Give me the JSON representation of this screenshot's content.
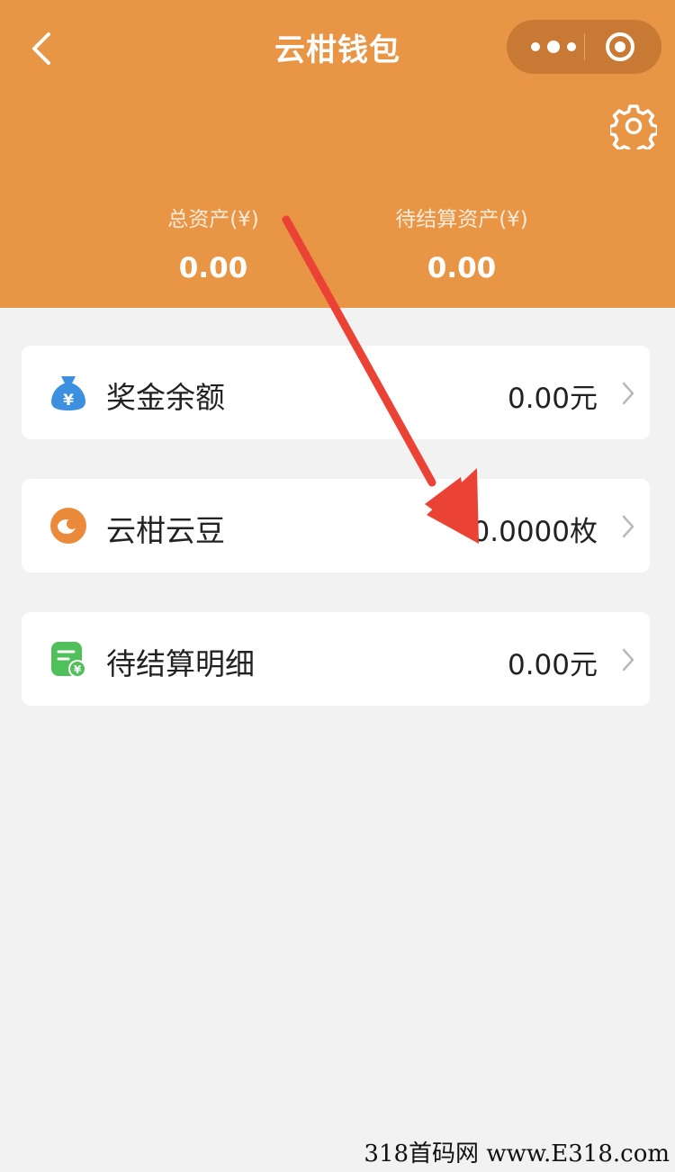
{
  "header": {
    "title": "云柑钱包",
    "icons": [
      "back-chevron-icon",
      "more-dots-icon",
      "target-icon",
      "gear-icon"
    ],
    "accent_color": "#e89545"
  },
  "stats": [
    {
      "label": "总资产(¥)",
      "value": "0.00"
    },
    {
      "label": "待结算资产(¥)",
      "value": "0.00"
    }
  ],
  "items": [
    {
      "label": "奖金余额",
      "value": "0.00元",
      "icon": "money-bag-icon"
    },
    {
      "label": "云柑云豆",
      "value": "0.0000枚",
      "icon": "bean-icon"
    },
    {
      "label": "待结算明细",
      "value": "0.00元",
      "icon": "settlement-list-icon"
    }
  ],
  "annotation": {
    "icon": "red-arrow-icon",
    "color": "#ea4335"
  },
  "watermark": "318首码网 www.E318.com"
}
